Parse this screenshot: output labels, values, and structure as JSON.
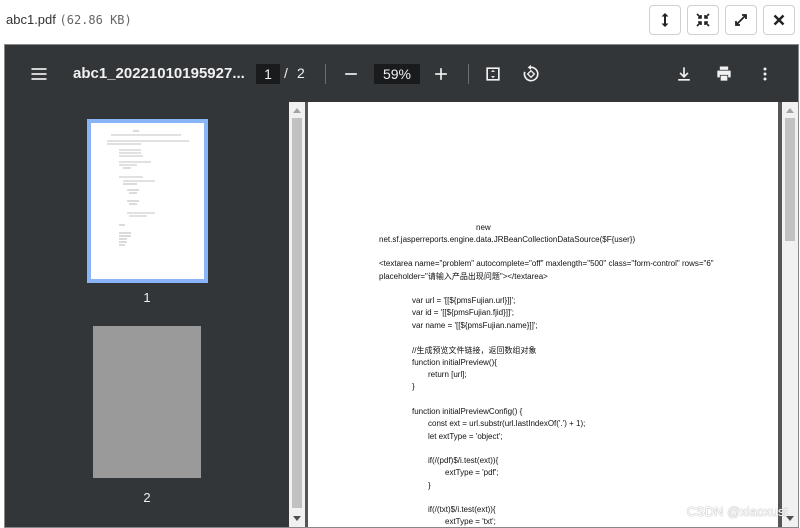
{
  "dialog": {
    "title": "abc1.pdf",
    "size": "(62.86 KB)",
    "buttons": [
      {
        "name": "vertical-resize",
        "icon": "vertical-arrows-icon"
      },
      {
        "name": "shrink",
        "icon": "collapse-icon"
      },
      {
        "name": "fullscreen",
        "icon": "expand-icon"
      },
      {
        "name": "close",
        "icon": "close-icon"
      }
    ]
  },
  "toolbar": {
    "file_name": "abc1_20221010195927...",
    "current_page": "1",
    "page_separator": "/",
    "total_pages": "2",
    "zoom": "59%"
  },
  "sidebar": {
    "pages": [
      {
        "label": "1",
        "selected": true
      },
      {
        "label": "2",
        "selected": false
      }
    ]
  },
  "document": {
    "lines": [
      "new",
      "net.sf.jasperreports.engine.data.JRBeanCollectionDataSource($F{user})",
      "<textarea name=\"problem\" autocomplete=\"off\" maxlength=\"500\" class=\"form-control\" rows=\"6\"",
      "placeholder=\"请输入产品出现问题\"></textarea>",
      "var url = '[[${pmsFujian.url}]]';",
      "var id = '[[${pmsFujian.fjid}]]';",
      "var name = '[[${pmsFujian.name}]]';",
      "//生成预览文件链接，返回数组对象",
      "function initialPreview(){",
      "return [url];",
      "}",
      "function initialPreviewConfig() {",
      "const ext = url.substr(url.lastIndexOf('.') + 1);",
      "let extType = 'object';",
      "if(/(pdf)$/i.test(ext)){",
      "extType = 'pdf';",
      "}",
      "if(/(txt)$/i.test(ext)){",
      "extType = 'txt';"
    ]
  },
  "watermark": "CSDN @xiaoxust",
  "colors": {
    "toolbar_bg": "#323639",
    "viewer_bg": "#525659",
    "thumb_highlight": "#8ab4f8"
  }
}
